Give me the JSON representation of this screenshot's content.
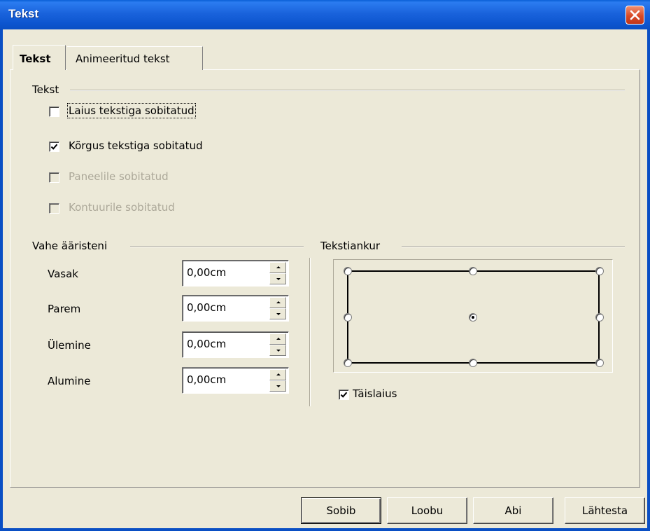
{
  "window": {
    "title": "Tekst"
  },
  "tabs": [
    {
      "label": "Tekst",
      "active": true
    },
    {
      "label": "Animeeritud tekst",
      "active": false
    }
  ],
  "text_group": {
    "label": "Tekst",
    "checkboxes": [
      {
        "label": "Laius tekstiga sobitatud",
        "checked": false,
        "enabled": true
      },
      {
        "label": "Kõrgus tekstiga sobitatud",
        "checked": true,
        "enabled": true
      },
      {
        "label": "Paneelile sobitatud",
        "checked": false,
        "enabled": false
      },
      {
        "label": "Kontuurile sobitatud",
        "checked": false,
        "enabled": false
      }
    ]
  },
  "spacing_group": {
    "label": "Vahe ääristeni",
    "fields": [
      {
        "label": "Vasak",
        "value": "0,00cm"
      },
      {
        "label": "Parem",
        "value": "0,00cm"
      },
      {
        "label": "Ülemine",
        "value": "0,00cm"
      },
      {
        "label": "Alumine",
        "value": "0,00cm"
      }
    ]
  },
  "anchor_group": {
    "label": "Tekstiankur",
    "selected_position": "center",
    "full_width": {
      "label": "Täislaius",
      "checked": true
    }
  },
  "buttons": {
    "ok": "Sobib",
    "cancel": "Loobu",
    "help": "Abi",
    "reset": "Lähtesta"
  },
  "colors": {
    "titlebar": "#0a5fd6",
    "dialog_bg": "#ece9d8",
    "disabled_text": "#aca899",
    "close_button": "#d84a26"
  }
}
